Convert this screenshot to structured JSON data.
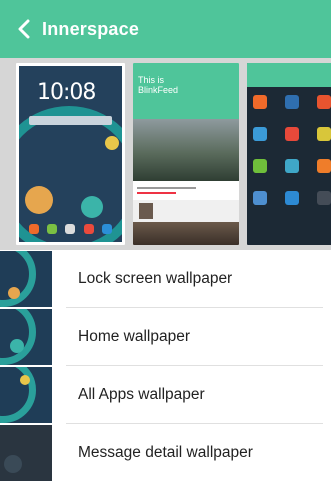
{
  "header": {
    "title": "Innerspace",
    "accent": "#4fc59a"
  },
  "previews": {
    "lock": {
      "clock": "10:08"
    },
    "blinkfeed": {
      "title_line1": "This is",
      "title_line2": "BlinkFeed"
    }
  },
  "list": {
    "items": [
      {
        "label": "Lock screen wallpaper"
      },
      {
        "label": "Home wallpaper"
      },
      {
        "label": "All Apps wallpaper"
      },
      {
        "label": "Message detail wallpaper"
      }
    ]
  }
}
